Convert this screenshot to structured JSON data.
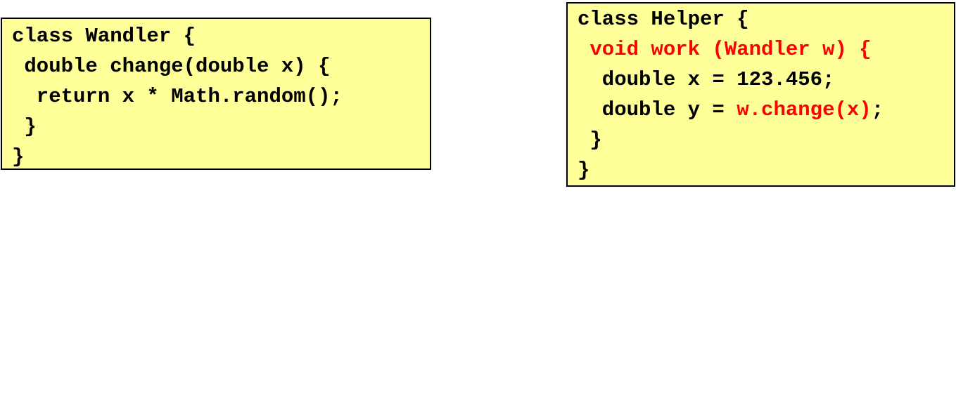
{
  "colors": {
    "box_background": "#ffff99",
    "border": "#000000",
    "text": "#000000",
    "highlight": "#ff0000"
  },
  "wandler": {
    "line1": "class Wandler {",
    "line2": " double change(double x) {",
    "line3": "  return x * Math.random();",
    "line4": " }",
    "line5": "}"
  },
  "helper": {
    "line1": "class Helper {",
    "line2": " void work (Wandler w) {",
    "line3": "  double x = 123.456;",
    "line4_prefix": "  double y = ",
    "line4_call": "w.change(x)",
    "line4_suffix": ";",
    "line5": " }",
    "line6": "}"
  }
}
